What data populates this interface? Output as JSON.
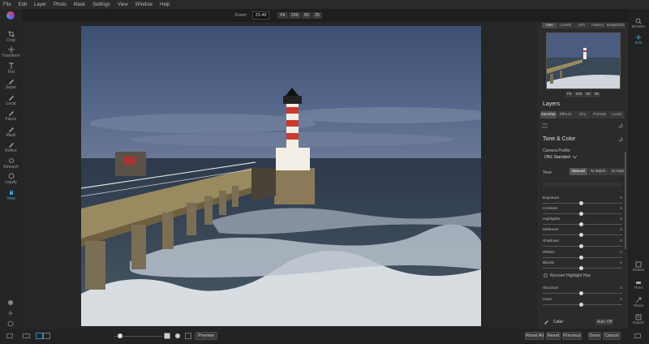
{
  "menu": [
    "File",
    "Edit",
    "Layer",
    "Photo",
    "Mask",
    "Settings",
    "View",
    "Window",
    "Help"
  ],
  "zoom": {
    "label": "Zoom:",
    "value": "23.49",
    "fit": [
      "Fit",
      "100",
      "50",
      "25"
    ]
  },
  "left_tools": [
    "Crop",
    "Transform",
    "Text",
    "Super",
    "Local",
    "Faces",
    "Mask",
    "Refine",
    "Retouch",
    "Liquify",
    "View"
  ],
  "right_bar": {
    "top": [
      "Browse",
      "Edit"
    ],
    "bottom": [
      "Resize",
      "Print",
      "Share",
      "Export"
    ]
  },
  "nav_tabs": [
    "Nav",
    "Levels",
    "Info",
    "History",
    "Snapshots"
  ],
  "nav_fit": [
    "Fit",
    "100",
    "50",
    "25"
  ],
  "layers_title": "Layers",
  "edit_tabs": [
    "Develop",
    "Effects",
    "Sky",
    "Portrait",
    "Local"
  ],
  "panel": {
    "title": "Tone & Color",
    "camera_profile_label": "Camera Profile:",
    "camera_profile_value": "ON1 Standard",
    "tone_label": "Tone:",
    "tone_modes": [
      "Manual",
      "AI Match",
      "AI Auto"
    ],
    "sliders": [
      "Exposure",
      "Contrast",
      "Highlights",
      "Midtones",
      "Shadows",
      "Whites",
      "Blacks"
    ],
    "recover_label": "Recover Highlight Hue",
    "sliders2": [
      "Structure",
      "Haze"
    ],
    "color_label": "Color:",
    "auto_off": "Auto Off"
  },
  "bottom": {
    "preview": "Preview",
    "reset_all": "Reset All",
    "reset": "Reset",
    "previous": "Previous",
    "done": "Done",
    "cancel": "Cancel"
  },
  "colors": {
    "accent": "#3aa6d8",
    "panel_bg": "#2b2b2b",
    "app_bg": "#1e1e1e"
  }
}
